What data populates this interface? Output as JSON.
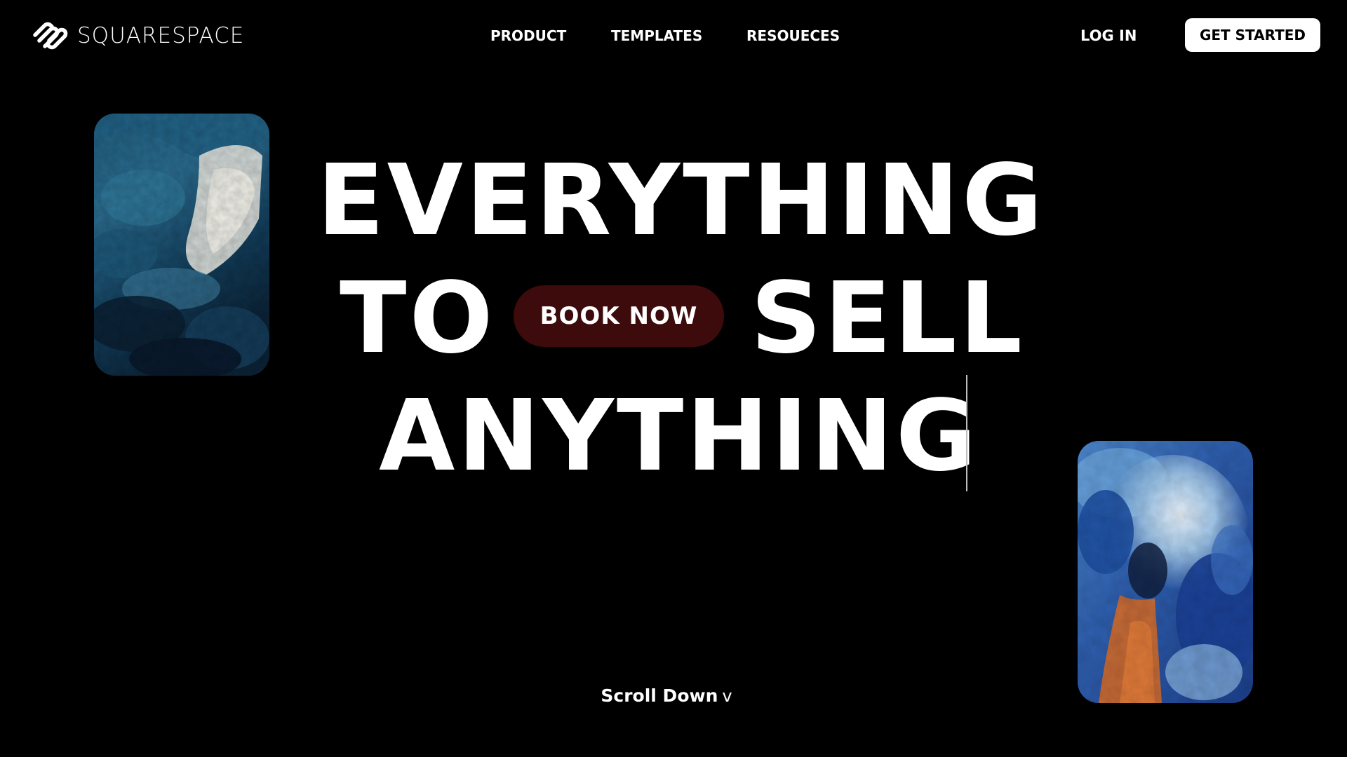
{
  "header": {
    "logo": {
      "icon": "squarespace-logo-icon",
      "text": "SQUARESPACE"
    },
    "nav": [
      {
        "label": "PRODUCT"
      },
      {
        "label": "TEMPLATES"
      },
      {
        "label": "RESOUECES"
      }
    ],
    "login_label": "LOG IN",
    "get_started_label": "GET STARTED"
  },
  "hero": {
    "line1": "EVERYTHING",
    "line2_left": "TO",
    "book_now_label": "BOOK NOW",
    "line2_right": "SELL",
    "line3": "ANYTHING"
  },
  "scroll": {
    "label": "Scroll Down",
    "chevron": "v"
  },
  "colors": {
    "background": "#000000",
    "text": "#ffffff",
    "book_now_bg": "#3d0b0b",
    "get_started_bg": "#ffffff"
  },
  "images": [
    {
      "name": "painting-left",
      "description_icon": "abstract-blue-painting-image"
    },
    {
      "name": "painting-right",
      "description_icon": "abstract-blue-orange-painting-image"
    }
  ]
}
